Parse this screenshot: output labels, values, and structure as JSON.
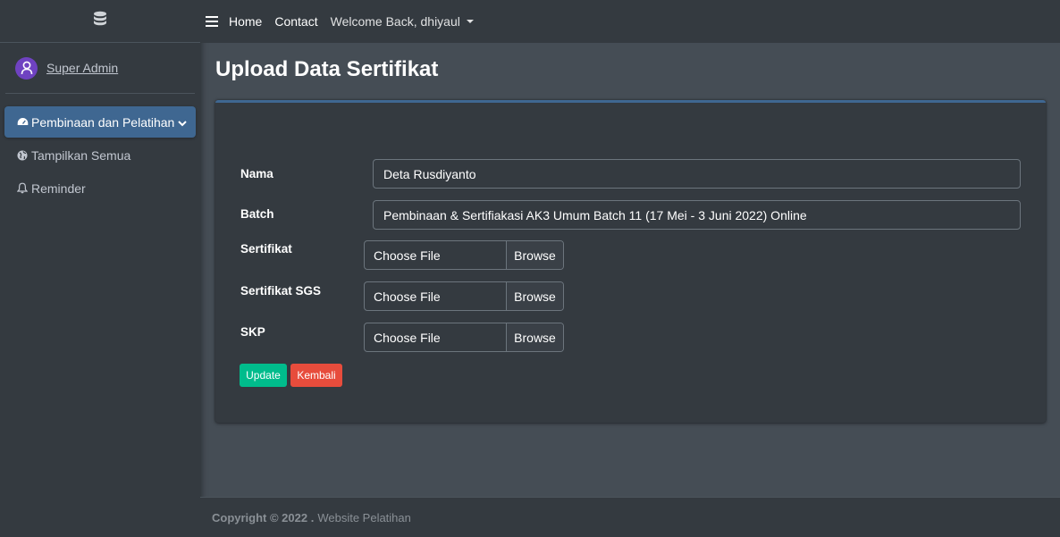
{
  "sidebar": {
    "brand_icon": "database-icon",
    "user": {
      "name": "Super Admin",
      "avatar_icon": "user-avatar-icon"
    },
    "items": [
      {
        "label": "Pembinaan dan Pelatihan",
        "icon": "dashboard-icon",
        "active": true
      },
      {
        "label": "Tampilkan Semua",
        "icon": "globe-icon"
      },
      {
        "label": "Reminder",
        "icon": "bell-icon"
      }
    ]
  },
  "topbar": {
    "home": "Home",
    "contact": "Contact",
    "welcome": "Welcome Back, dhiyaul"
  },
  "page": {
    "title": "Upload Data Sertifikat"
  },
  "form": {
    "nama": {
      "label": "Nama",
      "value": "Deta Rusdiyanto"
    },
    "batch": {
      "label": "Batch",
      "value": "Pembinaan & Sertifiakasi AK3 Umum Batch 11 (17 Mei - 3 Juni 2022) Online"
    },
    "sertifikat": {
      "label": "Sertifikat",
      "placeholder": "Choose File",
      "browse": "Browse"
    },
    "sertifikat_sgs": {
      "label": "Sertifikat SGS",
      "placeholder": "Choose File",
      "browse": "Browse"
    },
    "skp": {
      "label": "SKP",
      "placeholder": "Choose File",
      "browse": "Browse"
    },
    "update_label": "Update",
    "kembali_label": "Kembali"
  },
  "footer": {
    "copyright": "Copyright © 2022 .",
    "site": "Website Pelatihan"
  },
  "colors": {
    "sidebar_bg": "#343a40",
    "content_bg": "#454d55",
    "active_nav": "#3f6791",
    "success": "#00bc8c",
    "danger": "#e74c3c"
  }
}
